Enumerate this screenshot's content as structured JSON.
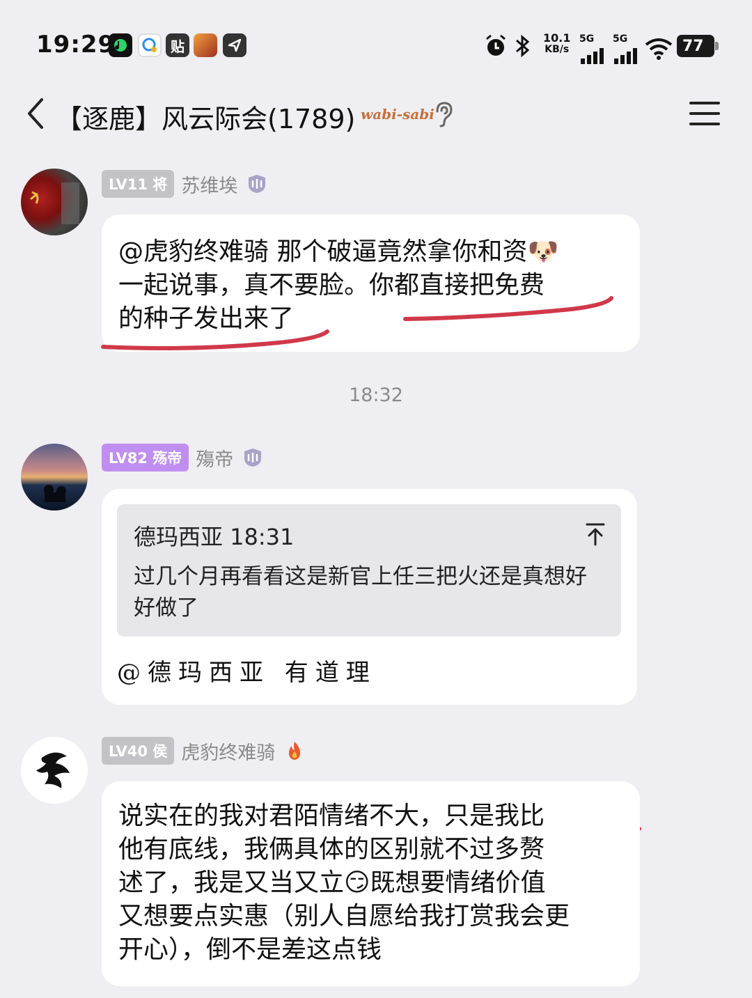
{
  "status_bar": {
    "time": "19:29",
    "net_speed_value": "10.1",
    "net_speed_unit": "KB/s",
    "signal_label_1": "5G",
    "signal_label_2": "5G",
    "battery": "77",
    "app_badge_text": "贴"
  },
  "header": {
    "title": "【逐鹿】风云际会(1789)",
    "wabi_label": "wabi-sabi"
  },
  "messages": [
    {
      "level": "LV11 将",
      "level_color": "#c3c3c7",
      "username": "苏维埃",
      "text": "@虎豹终难骑 那个破逼竟然拿你和资🐶\n一起说事，真不要脸。你都直接把免费\n的种子发出来了"
    },
    {
      "timestamp": "18:32"
    },
    {
      "level": "LV82 殇帝",
      "level_color": "#c08ef0",
      "username": "殤帝",
      "quote_author_time": "德玛西亚 18:31",
      "quote_text": "过几个月再看看这是新官上任三把火还是真想好好做了",
      "reply_text": "@德玛西亚 有道理"
    },
    {
      "level": "LV40 侯",
      "level_color": "#c3c3c7",
      "username": "虎豹终难骑",
      "text": "说实在的我对君陌情绪不大，只是我比\n他有底线，我俩具体的区别就不过多赘\n述了，我是又当又立😏既想要情绪价值\n又想要点实惠（别人自愿给我打赏我会更\n开心），倒不是差这点钱"
    }
  ],
  "colors": {
    "background": "#efeef2",
    "bubble": "#ffffff",
    "underline": "#d0394a"
  }
}
